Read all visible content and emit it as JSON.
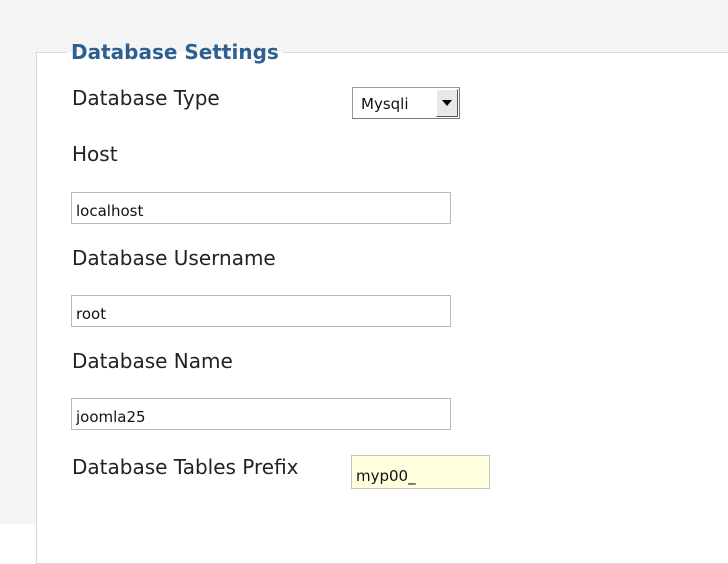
{
  "fieldset": {
    "legend": "Database Settings"
  },
  "fields": {
    "db_type": {
      "label": "Database Type",
      "value": "Mysqli"
    },
    "host": {
      "label": "Host",
      "value": "localhost"
    },
    "username": {
      "label": "Database Username",
      "value": "root"
    },
    "db_name": {
      "label": "Database Name",
      "value": "joomla25"
    },
    "prefix": {
      "label": "Database Tables Prefix",
      "value": "myp00_"
    }
  }
}
